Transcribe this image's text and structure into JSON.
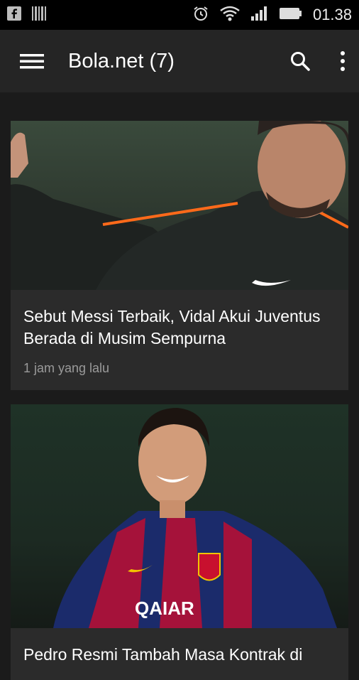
{
  "status_bar": {
    "left_icons": [
      "facebook-icon",
      "barcode-icon"
    ],
    "right_icons": [
      "alarm-icon",
      "wifi-icon",
      "signal-icon",
      "battery-icon"
    ],
    "time": "01.38"
  },
  "app_bar": {
    "title": "Bola.net (7)",
    "icons": [
      "menu-icon",
      "search-icon",
      "overflow-menu-icon"
    ]
  },
  "articles": [
    {
      "title": "Sebut Messi Terbaik, Vidal Akui Juventus Berada di Musim Sempurna",
      "time": "1 jam yang lalu",
      "image": "football-player-photo"
    },
    {
      "title": "Pedro Resmi Tambah Masa Kontrak di",
      "image": "football-player-photo"
    }
  ]
}
